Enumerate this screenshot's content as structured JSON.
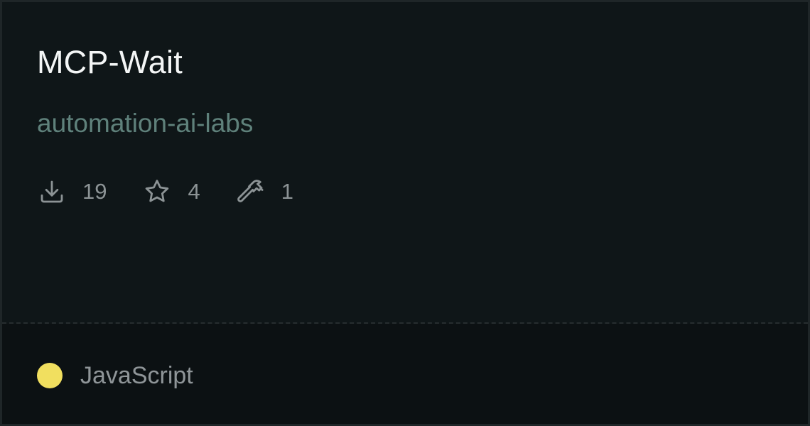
{
  "repo": {
    "name": "MCP-Wait",
    "owner": "automation-ai-labs"
  },
  "stats": {
    "downloads": "19",
    "stars": "4",
    "tools": "1"
  },
  "language": {
    "name": "JavaScript",
    "color": "#f1df5f"
  },
  "icons": {
    "downloads": "download-icon",
    "stars": "star-icon",
    "tools": "hammer-icon"
  }
}
